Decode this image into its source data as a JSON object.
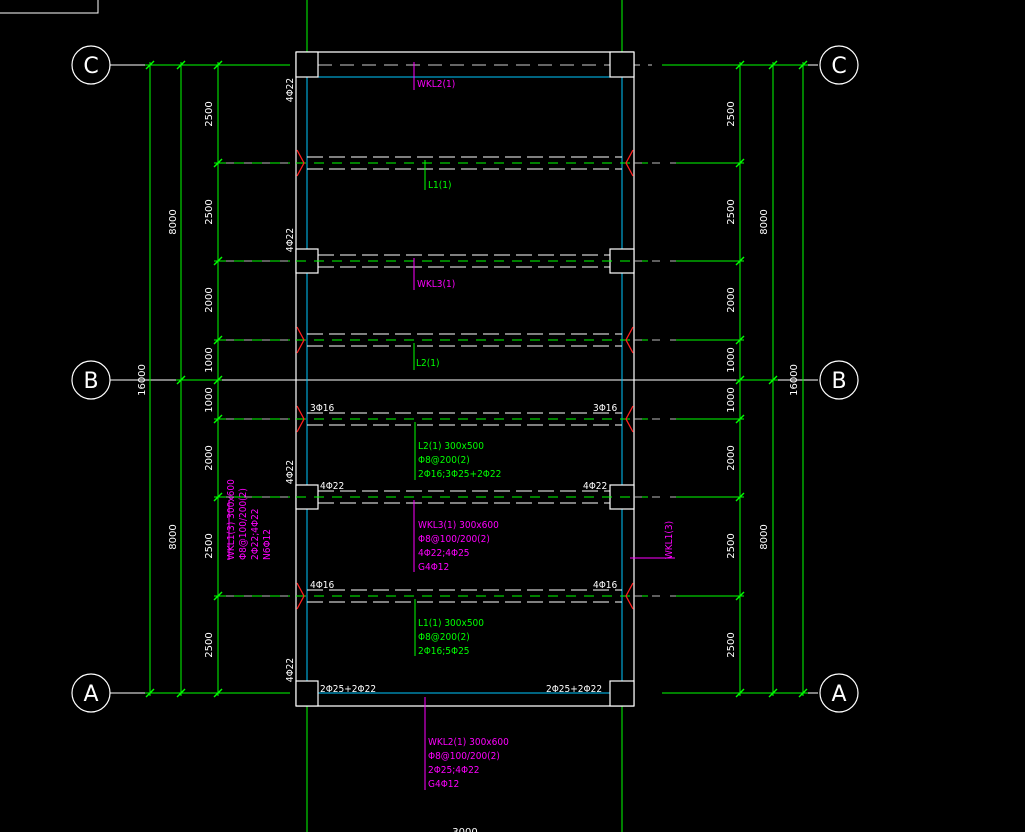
{
  "axes": [
    "C",
    "B",
    "A"
  ],
  "dimensions": {
    "left_inner": [
      "2500",
      "2500",
      "2000",
      "1000",
      "1000",
      "2000",
      "2500",
      "2500"
    ],
    "left_middle": [
      "8000",
      "8000"
    ],
    "left_total": "16000",
    "right_inner": [
      "2500",
      "2500",
      "2000",
      "1000",
      "1000",
      "2000",
      "2500",
      "2500"
    ],
    "right_middle": [
      "8000",
      "8000"
    ],
    "right_total": "16000",
    "bottom": "3000"
  },
  "labels": {
    "wkl2_top": "WKL2(1)",
    "l1_top": "L1(1)",
    "wkl3_top": "WKL3(1)",
    "l2_top": "L2(1)",
    "wkl1_right": "WKL1(3)"
  },
  "annotations": {
    "l2": [
      "L2(1) 300x500",
      "Φ8@200(2)",
      "2Φ16;3Φ25+2Φ22"
    ],
    "wkl3": [
      "WKL3(1) 300x600",
      "Φ8@100/200(2)",
      "4Φ22;4Φ25",
      "G4Φ12"
    ],
    "l1": [
      "L1(1) 300x500",
      "Φ8@200(2)",
      "2Φ16;5Φ25"
    ],
    "wkl2": [
      "WKL2(1) 300x600",
      "Φ8@100/200(2)",
      "2Φ25;4Φ22",
      "G4Φ12"
    ],
    "wkl1": [
      "WKL1(3) 300x600",
      "Φ8@100/200(2)",
      "2Φ22;4Φ22",
      "N6Φ12"
    ]
  },
  "rebar": {
    "col_top": "4Φ22",
    "col_wkl3": "4Φ22",
    "col_mid": "4Φ22",
    "col_bot": "4Φ22",
    "l2_left": "3Φ16",
    "l2_right": "3Φ16",
    "wkl3_left": "4Φ22",
    "wkl3_right": "4Φ22",
    "l1_left": "4Φ16",
    "l1_right": "4Φ16",
    "wkl2_bot_left": "2Φ25+2Φ22",
    "wkl2_bot_right": "2Φ25+2Φ22"
  },
  "colors": {
    "background": "#000000",
    "dimension": "#00ff00",
    "beam_outline": "#ffffff",
    "wall": "#00c8ff",
    "label": "#ff00ff",
    "beam_note": "#00ff00",
    "hatch": "#ff0000"
  }
}
